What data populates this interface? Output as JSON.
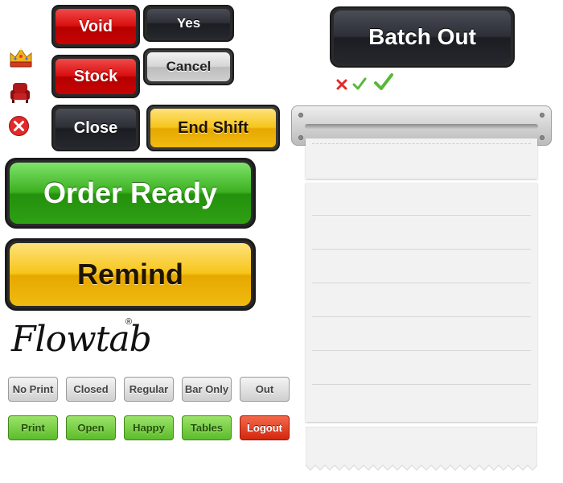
{
  "buttons": {
    "void": "Void",
    "yes": "Yes",
    "stock": "Stock",
    "cancel": "Cancel",
    "close": "Close",
    "end_shift": "End Shift",
    "batch_out": "Batch Out",
    "order_ready": "Order Ready",
    "remind": "Remind"
  },
  "logo": {
    "text": "Flowtab",
    "mark": "®"
  },
  "small_buttons_row1": [
    "No Print",
    "Closed",
    "Regular",
    "Bar Only",
    "Out"
  ],
  "small_buttons_row2": [
    "Print",
    "Open",
    "Happy",
    "Tables",
    "Logout"
  ],
  "icons": [
    "crown-icon",
    "armchair-icon",
    "close-circle-icon",
    "x-mark-icon",
    "check-small-icon",
    "check-large-icon"
  ],
  "colors": {
    "red": "#d90e0e",
    "dark": "#2c2f36",
    "grey": "#cfcfcf",
    "yellow": "#f6c51a",
    "green": "#3cb021",
    "logout_red": "#d3260f"
  }
}
